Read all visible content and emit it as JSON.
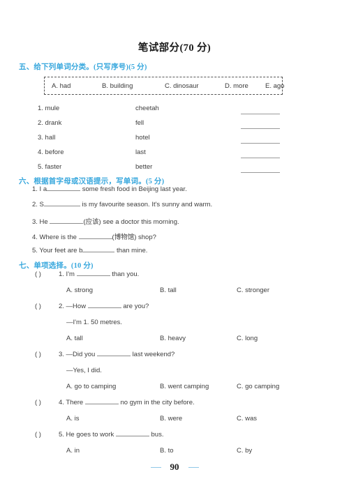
{
  "paper": {
    "title": "笔试部分(70 分)",
    "page_number": "90",
    "heading_color": "#37a7dd"
  },
  "section_five": {
    "heading": "五、给下列单词分类。(只写序号)(5 分)",
    "word_bank": [
      {
        "label": "A. had"
      },
      {
        "label": "B. building"
      },
      {
        "label": "C. dinosaur"
      },
      {
        "label": "D. more"
      },
      {
        "label": "E. ago"
      }
    ],
    "rows": [
      {
        "num": "1. mule",
        "word2": "cheetah"
      },
      {
        "num": "2. drank",
        "word2": "fell"
      },
      {
        "num": "3. hall",
        "word2": "hotel"
      },
      {
        "num": "4. before",
        "word2": "last"
      },
      {
        "num": "5. faster",
        "word2": "better"
      }
    ]
  },
  "section_six": {
    "heading": "六、根据首字母或汉语提示，写单词。(5 分)",
    "items": [
      {
        "pre": "1. I a",
        "post": "some fresh food in Beijing last year."
      },
      {
        "pre": "2. S",
        "post": "is my favourite season. It's sunny and warm."
      },
      {
        "pre": "3. He",
        "post": "(应该) see a doctor this morning."
      },
      {
        "pre": "4. Where is the",
        "post": "(博物馆) shop?"
      },
      {
        "pre": "5. Your feet are b",
        "post": "than mine."
      }
    ]
  },
  "section_seven": {
    "heading": "七、单项选择。(10 分)",
    "paren": "(       )",
    "questions": [
      {
        "stem_pre": "1. I'm",
        "stem_post": "than you.",
        "cont": "",
        "options": [
          "A. strong",
          "B. tall",
          "C. stronger"
        ]
      },
      {
        "stem_pre": "2. —How",
        "stem_post": "are you?",
        "cont": "—I'm 1. 50 metres.",
        "options": [
          "A. tall",
          "B. heavy",
          "C. long"
        ]
      },
      {
        "stem_pre": "3. —Did you",
        "stem_post": "last weekend?",
        "cont": "—Yes, I did.",
        "options": [
          "A. go to camping",
          "B. went camping",
          "C. go camping"
        ]
      },
      {
        "stem_pre": "4. There",
        "stem_post": "no gym in the city before.",
        "cont": "",
        "options": [
          "A. is",
          "B. were",
          "C. was"
        ]
      },
      {
        "stem_pre": "5. He goes to work",
        "stem_post": "bus.",
        "cont": "",
        "options": [
          "A. in",
          "B. to",
          "C. by"
        ]
      }
    ]
  }
}
